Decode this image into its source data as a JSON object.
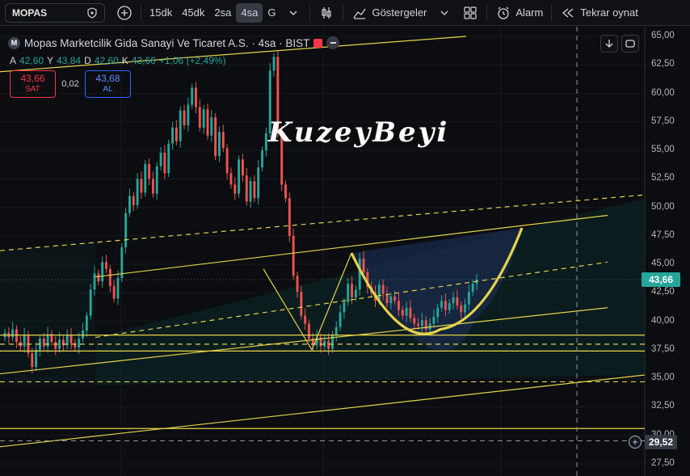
{
  "toolbar": {
    "symbol": "MOPAS",
    "intervals": [
      "15dk",
      "45dk",
      "2sa",
      "4sa",
      "G"
    ],
    "active_interval": "4sa",
    "indicators_label": "Göstergeler",
    "alert_label": "Alarm",
    "replay_label": "Tekrar oynat"
  },
  "legend": {
    "logo_letter": "M",
    "title": "Mopas Marketcilik Gida Sanayi Ve Ticaret A.S. · 4sa · BIST",
    "ohlc": [
      {
        "k": "A",
        "v": "42,60"
      },
      {
        "k": "Y",
        "v": "43,84"
      },
      {
        "k": "D",
        "v": "42,60"
      },
      {
        "k": "K",
        "v": "43,66"
      },
      {
        "k": "",
        "v": "+1,06 (+2,49%)"
      }
    ]
  },
  "trade": {
    "sell_price": "43,66",
    "sell_label": "SAT",
    "spread": "0,02",
    "buy_price": "43,68",
    "buy_label": "AL"
  },
  "watermark": "KuzeyBeyi",
  "axis": {
    "ticks": [
      "65,00",
      "62,50",
      "60,00",
      "57,50",
      "55,00",
      "52,50",
      "50,00",
      "47,50",
      "45,00",
      "42,50",
      "40,00",
      "37,50",
      "35,00",
      "32,50",
      "30,00",
      "27,50"
    ],
    "last_price": "43,66",
    "crosshair_price": "29,52"
  },
  "colors": {
    "up": "#26a69a",
    "down": "#ef5350",
    "drawing": "#e6d24a",
    "cup_fill": "#1a2a4a"
  },
  "chart_data": {
    "type": "candlestick",
    "ylim": [
      27.5,
      65
    ],
    "closes": [
      39.0,
      38.6,
      39.3,
      38.2,
      37.8,
      38.8,
      37.2,
      36.0,
      37.5,
      38.5,
      37.8,
      38.9,
      38.2,
      37.6,
      38.4,
      37.9,
      38.8,
      38.1,
      37.7,
      38.5,
      39.2,
      40.5,
      42.8,
      44.2,
      43.5,
      45.2,
      44.6,
      43.1,
      42.0,
      43.8,
      46.5,
      49.5,
      51.0,
      50.2,
      52.5,
      51.3,
      53.8,
      52.5,
      51.2,
      53.6,
      54.8,
      53.0,
      55.6,
      57.0,
      55.8,
      58.5,
      57.2,
      59.0,
      60.5,
      58.8,
      57.0,
      58.6,
      56.3,
      57.9,
      54.5,
      56.6,
      55.2,
      53.0,
      52.0,
      51.2,
      54.2,
      52.8,
      50.5,
      52.3,
      50.8,
      53.5,
      55.0,
      56.5,
      62.0,
      63.2,
      56.5,
      52.0,
      50.8,
      47.5,
      44.0,
      42.6,
      40.5,
      39.8,
      38.5,
      37.9,
      38.6,
      37.8,
      38.3,
      37.6,
      38.8,
      39.5,
      40.8,
      41.7,
      43.3,
      42.1,
      42.8,
      45.5,
      44.3,
      43.0,
      42.5,
      41.8,
      43.2,
      42.4,
      41.6,
      42.2,
      41.8,
      41.0,
      40.5,
      41.2,
      40.3,
      39.8,
      39.6,
      40.1,
      39.3,
      39.8,
      40.4,
      41.2,
      41.8,
      41.0,
      41.6,
      42.1,
      41.4,
      40.8,
      41.5,
      42.6,
      43.3,
      43.66
    ]
  }
}
